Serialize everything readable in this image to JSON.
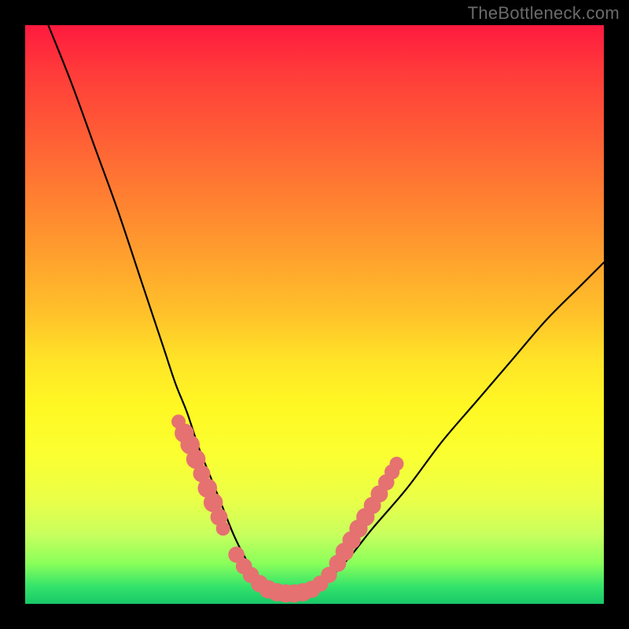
{
  "watermark": "TheBottleneck.com",
  "colors": {
    "frame": "#000000",
    "cluster_fill": "#e57171",
    "curve_stroke": "#000000"
  },
  "chart_data": {
    "type": "line",
    "title": "",
    "xlabel": "",
    "ylabel": "",
    "xlim": [
      0,
      100
    ],
    "ylim": [
      0,
      100
    ],
    "grid": false,
    "legend": false,
    "note": "No tick labels or axis labels are visible in the image; x and y are expressed as percent of plot width/height. Values are estimated from the rendered pixels.",
    "series": [
      {
        "name": "curve",
        "x": [
          4,
          8,
          12,
          16,
          20,
          22,
          24,
          26,
          28,
          30,
          32,
          34,
          36,
          38,
          40,
          44,
          48,
          52,
          56,
          60,
          66,
          72,
          78,
          84,
          90,
          96,
          100
        ],
        "y": [
          100,
          90,
          79,
          68,
          56,
          50,
          44,
          38,
          33,
          27,
          22,
          17,
          12,
          8,
          5,
          2,
          2,
          4,
          8,
          13,
          20,
          28,
          35,
          42,
          49,
          55,
          59
        ]
      }
    ],
    "clusters": [
      {
        "name": "left-branch-dots",
        "points": [
          {
            "x": 26.5,
            "y": 31.5,
            "r": 0.9
          },
          {
            "x": 27.5,
            "y": 29.5,
            "r": 1.4
          },
          {
            "x": 28.5,
            "y": 27.5,
            "r": 1.4
          },
          {
            "x": 29.5,
            "y": 25.0,
            "r": 1.4
          },
          {
            "x": 30.5,
            "y": 22.5,
            "r": 1.2
          },
          {
            "x": 31.5,
            "y": 20.0,
            "r": 1.4
          },
          {
            "x": 32.5,
            "y": 17.5,
            "r": 1.4
          },
          {
            "x": 33.5,
            "y": 15.0,
            "r": 1.2
          },
          {
            "x": 34.2,
            "y": 13.0,
            "r": 0.9
          }
        ]
      },
      {
        "name": "valley-dots",
        "points": [
          {
            "x": 36.5,
            "y": 8.5,
            "r": 1.1
          },
          {
            "x": 37.8,
            "y": 6.5,
            "r": 1.1
          },
          {
            "x": 39.0,
            "y": 5.0,
            "r": 1.1
          },
          {
            "x": 40.5,
            "y": 3.5,
            "r": 1.2
          },
          {
            "x": 42.0,
            "y": 2.5,
            "r": 1.3
          },
          {
            "x": 43.5,
            "y": 2.0,
            "r": 1.3
          },
          {
            "x": 45.0,
            "y": 1.8,
            "r": 1.3
          },
          {
            "x": 46.5,
            "y": 1.8,
            "r": 1.3
          },
          {
            "x": 48.0,
            "y": 2.0,
            "r": 1.3
          },
          {
            "x": 49.5,
            "y": 2.5,
            "r": 1.2
          },
          {
            "x": 51.0,
            "y": 3.5,
            "r": 1.1
          }
        ]
      },
      {
        "name": "right-branch-dots",
        "points": [
          {
            "x": 52.5,
            "y": 5.0,
            "r": 1.1
          },
          {
            "x": 54.0,
            "y": 7.0,
            "r": 1.2
          },
          {
            "x": 55.2,
            "y": 9.0,
            "r": 1.3
          },
          {
            "x": 56.4,
            "y": 11.0,
            "r": 1.3
          },
          {
            "x": 57.6,
            "y": 13.0,
            "r": 1.3
          },
          {
            "x": 58.8,
            "y": 15.0,
            "r": 1.3
          },
          {
            "x": 60.0,
            "y": 17.0,
            "r": 1.2
          },
          {
            "x": 61.2,
            "y": 19.0,
            "r": 1.2
          },
          {
            "x": 62.4,
            "y": 21.0,
            "r": 1.1
          },
          {
            "x": 63.4,
            "y": 22.8,
            "r": 1.0
          },
          {
            "x": 64.2,
            "y": 24.2,
            "r": 0.9
          }
        ]
      }
    ]
  }
}
